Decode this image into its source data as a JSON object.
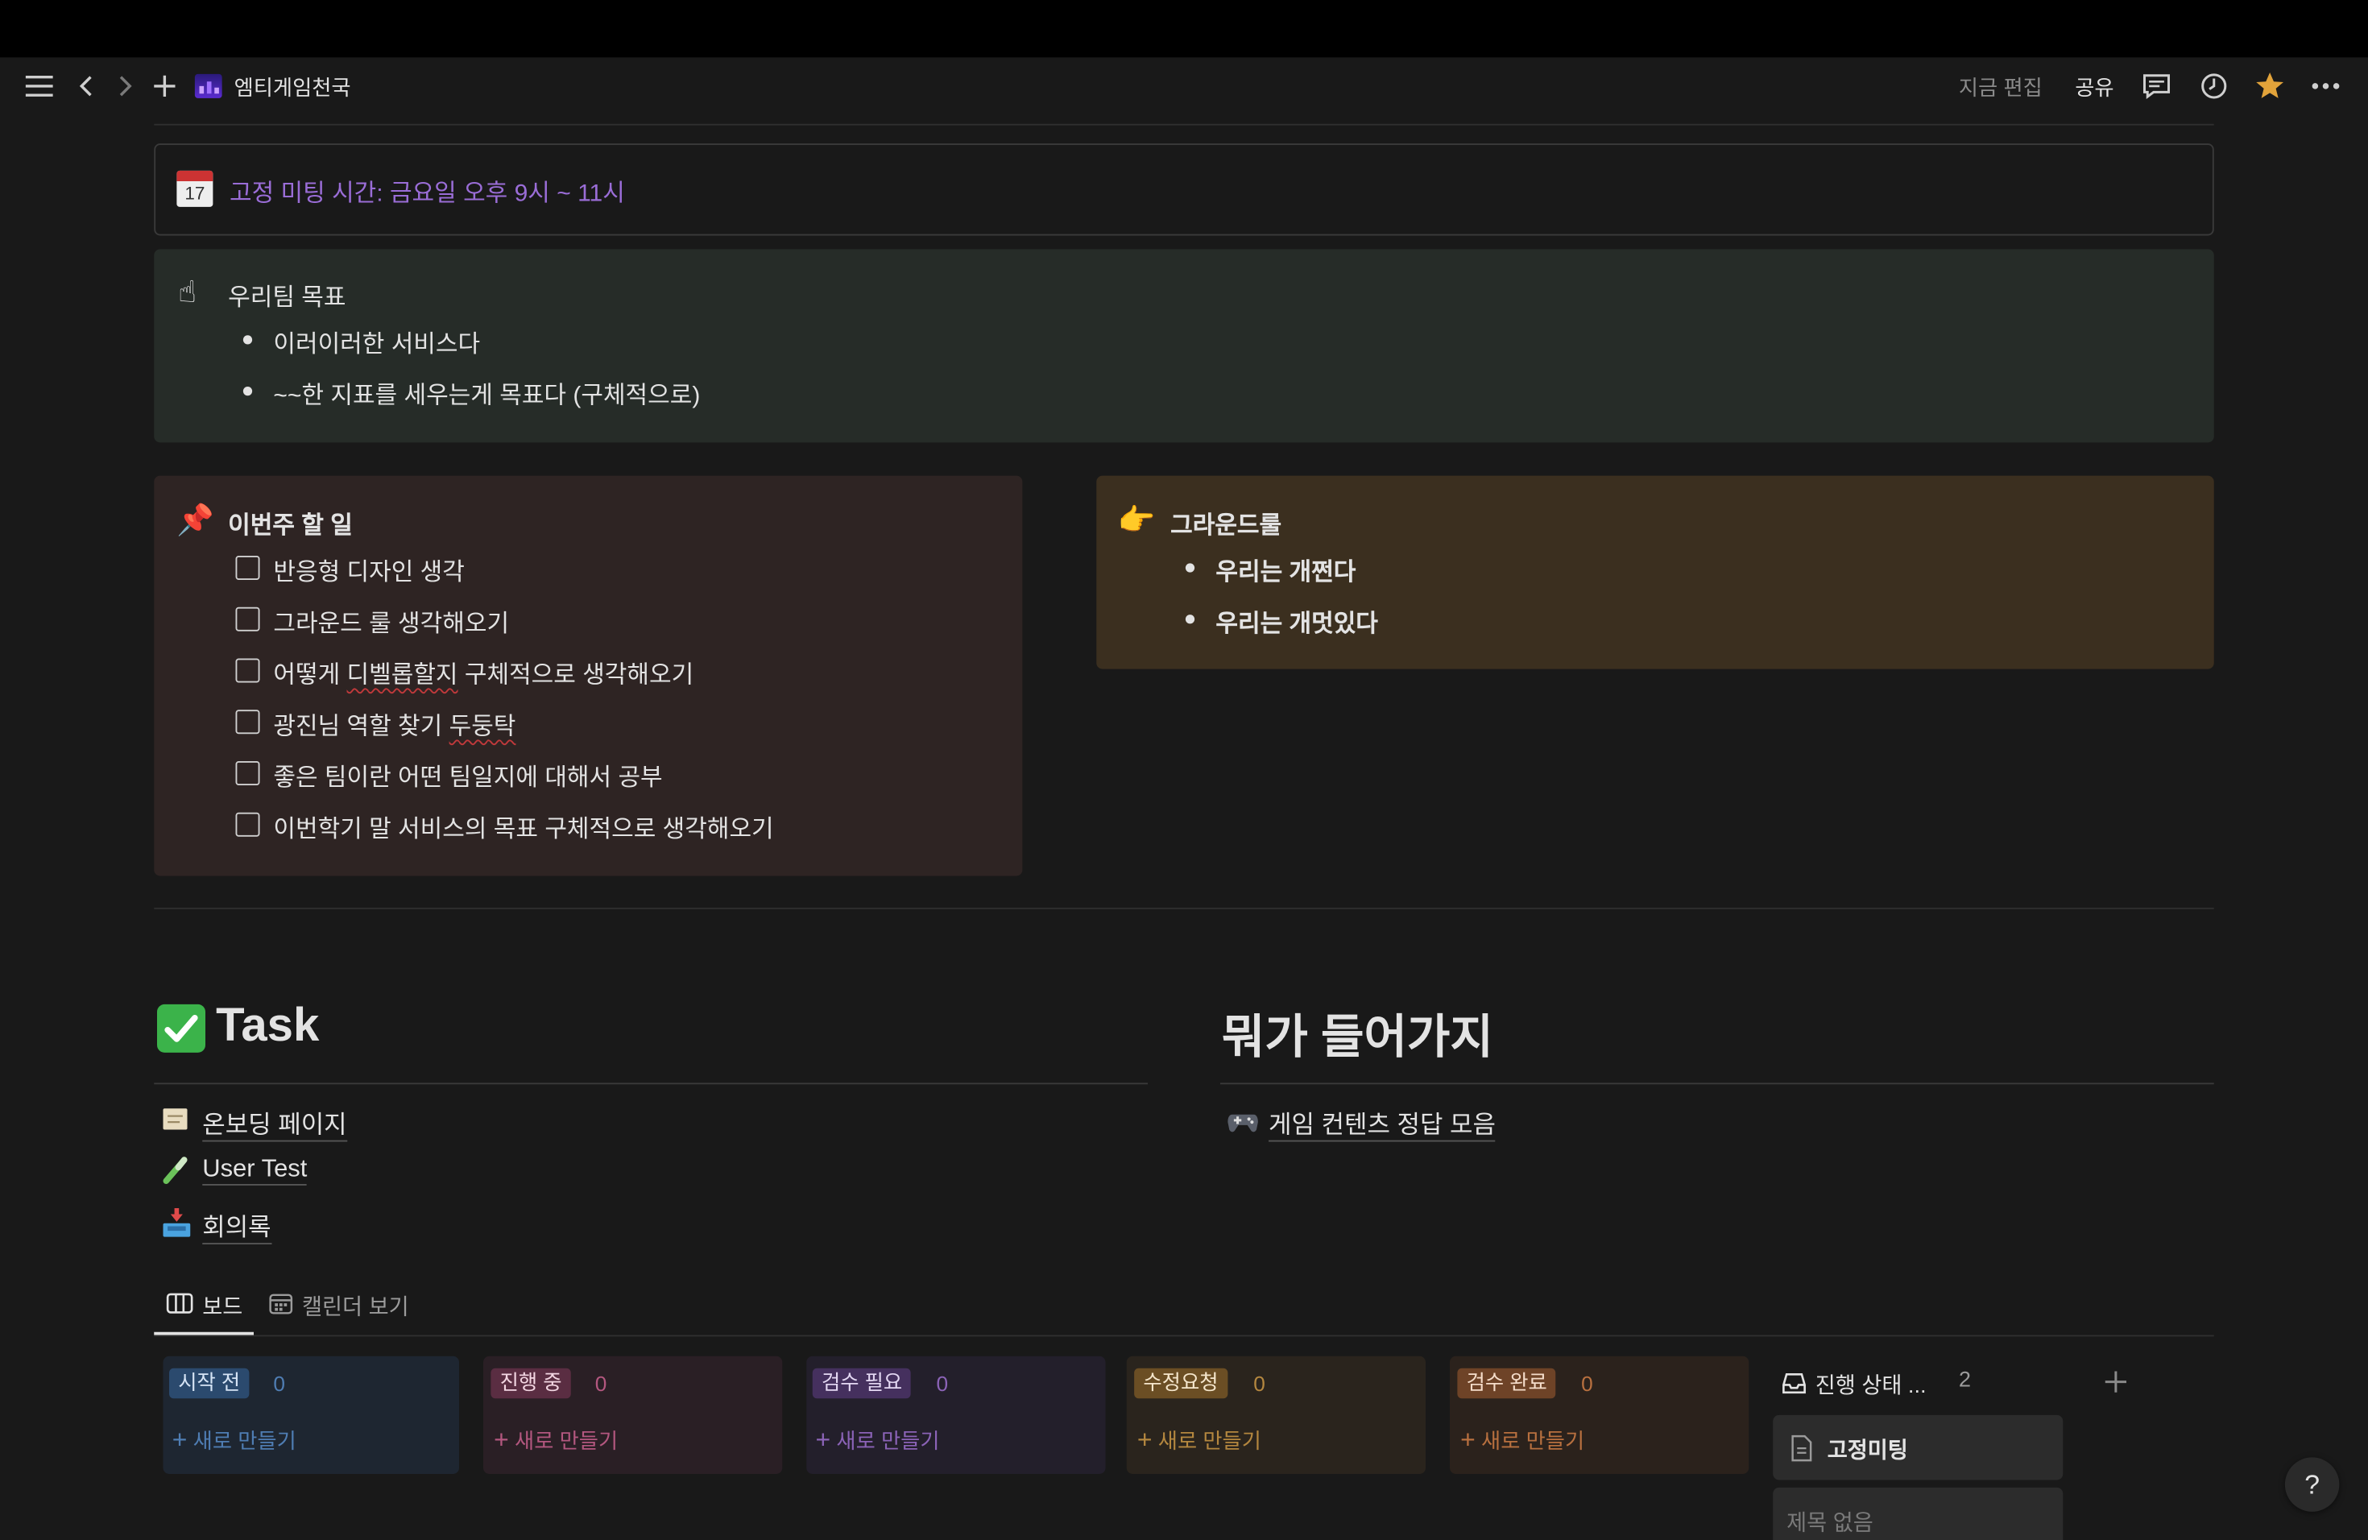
{
  "topbar": {
    "breadcrumb": "엠티게임천국",
    "edited": "지금 편집",
    "share": "공유"
  },
  "meeting_callout": {
    "text": "고정 미팅 시간: 금요일 오후 9시 ~ 11시",
    "color": "#9a6dd7"
  },
  "goal_callout": {
    "title": "우리팀 목표",
    "items": [
      "이러이러한 서비스다",
      "~~한 지표를 세우는게 목표다 (구체적으로)"
    ]
  },
  "todo_callout": {
    "title": "이번주 할 일",
    "items": [
      {
        "text": "반응형 디자인 생각",
        "checked": false
      },
      {
        "text": "그라운드 룰 생각해오기",
        "checked": false
      },
      {
        "pre": "어떻게 ",
        "sq": "디벨롭할지",
        "post": " 구체적으로 생각해오기",
        "checked": false
      },
      {
        "pre": "광진님 역할 찾기 ",
        "sq": "두둥탁",
        "post": "",
        "checked": false
      },
      {
        "text": "좋은 팀이란 어떤 팀일지에 대해서 공부",
        "checked": false
      },
      {
        "text": "이번학기 말 서비스의 목표 구체적으로 생각해오기",
        "checked": false
      }
    ]
  },
  "ground_callout": {
    "title": "그라운드룰",
    "items": [
      "우리는 개쩐다",
      "우리는 개멋있다"
    ]
  },
  "task_section": {
    "heading": "Task",
    "pages": [
      "온보딩 페이지",
      "User Test",
      "회의록"
    ]
  },
  "other_section": {
    "heading": "뭐가 들어가지",
    "pages": [
      "게임 컨텐츠 정답 모음"
    ]
  },
  "views": {
    "board": "보드",
    "calendar": "캘린더 보기"
  },
  "board": {
    "new_label": "새로 만들기",
    "columns": [
      {
        "name": "시작 전",
        "count": "0"
      },
      {
        "name": "진행 중",
        "count": "0"
      },
      {
        "name": "검수 필요",
        "count": "0"
      },
      {
        "name": "수정요청",
        "count": "0"
      },
      {
        "name": "검수 완료",
        "count": "0"
      }
    ],
    "hidden_group": {
      "name": "진행 상태 ...",
      "count": "2"
    },
    "cards": [
      "고정미팅",
      "제목 없음"
    ]
  },
  "help": "?"
}
